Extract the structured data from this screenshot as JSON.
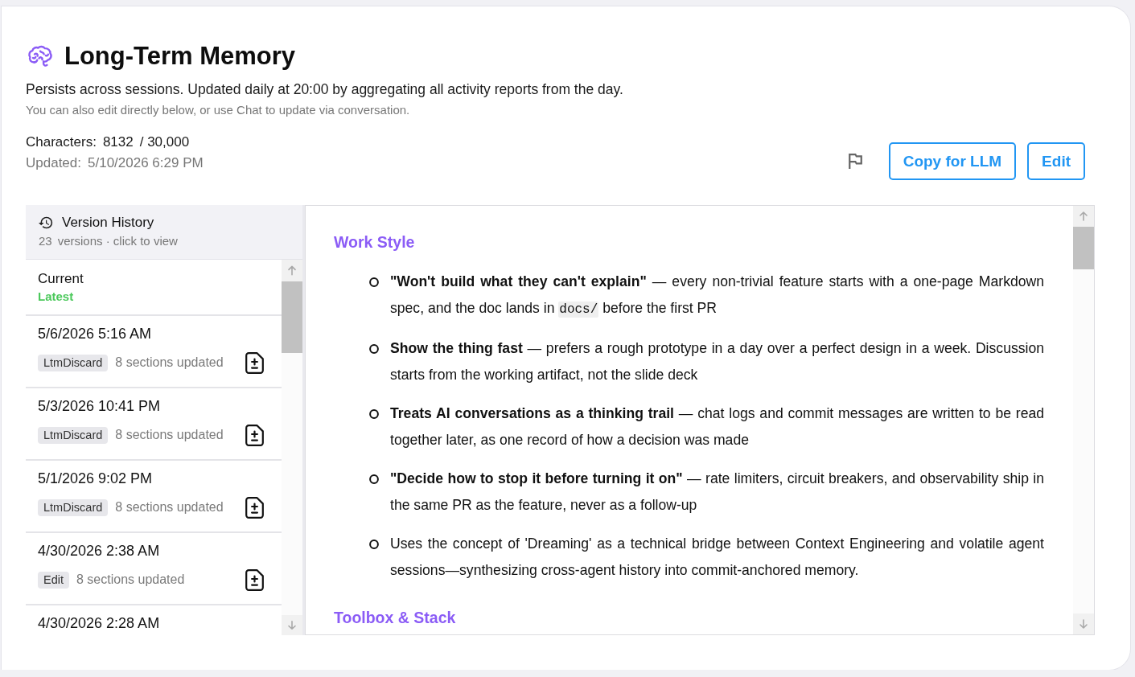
{
  "header": {
    "title": "Long-Term Memory",
    "description": "Persists across sessions. Updated daily at 20:00 by aggregating all activity reports from the day.",
    "hint": "You can also edit directly below, or use Chat to update via conversation.",
    "characters": {
      "label": "Characters:",
      "count": "8132",
      "limit": "/ 30,000"
    },
    "updated": {
      "label": "Updated:",
      "value": "5/10/2026 6:29 PM"
    }
  },
  "actions": {
    "buttons": [
      "Copy for LLM",
      "Edit"
    ]
  },
  "version_history": {
    "title": "Version History",
    "count": "23",
    "count_label": "versions · click to view",
    "versions": [
      {
        "kind": "current",
        "title": "Current",
        "status": "Latest"
      },
      {
        "kind": "version",
        "date": "5/6/2026 5:16 AM",
        "tag": "LtmDiscard",
        "summary": "8 sections updated"
      },
      {
        "kind": "version",
        "date": "5/3/2026 10:41 PM",
        "tag": "LtmDiscard",
        "summary": "8 sections updated"
      },
      {
        "kind": "version",
        "date": "5/1/2026 9:02 PM",
        "tag": "LtmDiscard",
        "summary": "8 sections updated"
      },
      {
        "kind": "version",
        "date": "4/30/2026 2:38 AM",
        "tag": "Edit",
        "summary": "8 sections updated"
      },
      {
        "kind": "version",
        "date": "4/30/2026 2:28 AM"
      }
    ]
  },
  "document": {
    "sections": [
      {
        "heading": "Work Style",
        "items": [
          {
            "parts": [
              {
                "kind": "strong",
                "text": "\"Won't build what they can't explain\""
              },
              {
                "kind": "plain",
                "text": " — every non-trivial feature starts with a one-page Markdown spec, and the doc lands in "
              },
              {
                "kind": "code",
                "text": "docs/"
              },
              {
                "kind": "plain",
                "text": " before the first PR"
              }
            ]
          },
          {
            "parts": [
              {
                "kind": "strong",
                "text": "Show the thing fast"
              },
              {
                "kind": "plain",
                "text": " — prefers a rough prototype in a day over a perfect design in a week. Discussion starts from the working artifact, not the slide deck"
              }
            ]
          },
          {
            "parts": [
              {
                "kind": "strong",
                "text": "Treats AI conversations as a thinking trail"
              },
              {
                "kind": "plain",
                "text": " — chat logs and commit messages are written to be read together later, as one record of how a decision was made"
              }
            ]
          },
          {
            "parts": [
              {
                "kind": "strong",
                "text": "\"Decide how to stop it before turning it on\""
              },
              {
                "kind": "plain",
                "text": " — rate limiters, circuit breakers, and observability ship in the same PR as the feature, never as a follow-up"
              }
            ]
          },
          {
            "parts": [
              {
                "kind": "plain",
                "text": "Uses the concept of 'Dreaming' as a technical bridge between Context Engineering and volatile agent sessions—synthesizing cross-agent history into commit-anchored memory."
              }
            ]
          }
        ]
      },
      {
        "heading": "Toolbox & Stack"
      }
    ]
  }
}
